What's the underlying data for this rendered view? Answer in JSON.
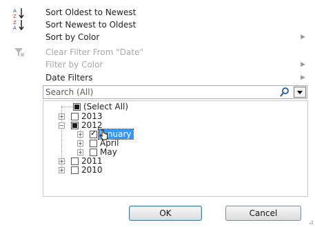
{
  "menu": {
    "items": [
      {
        "label": "Sort Oldest to Newest",
        "enabled": true,
        "submenu": false,
        "icon": "sort-ascending-icon"
      },
      {
        "label": "Sort Newest to Oldest",
        "enabled": true,
        "submenu": false,
        "icon": "sort-descending-icon"
      },
      {
        "label": "Sort by Color",
        "enabled": true,
        "submenu": true,
        "icon": ""
      },
      {
        "label": "Clear Filter From \"Date\"",
        "enabled": false,
        "submenu": false,
        "icon": "clear-filter-icon"
      },
      {
        "label": "Filter by Color",
        "enabled": false,
        "submenu": true,
        "icon": ""
      },
      {
        "label": "Date Filters",
        "enabled": true,
        "submenu": true,
        "icon": ""
      }
    ]
  },
  "search": {
    "placeholder": "Search (All)"
  },
  "tree": {
    "nodes": [
      {
        "label": "(Select All)",
        "state": "mixed",
        "expander": "",
        "selected": false
      },
      {
        "label": "2013",
        "state": "unchecked",
        "expander": "+",
        "selected": false
      },
      {
        "label": "2012",
        "state": "mixed",
        "expander": "−",
        "selected": false
      },
      {
        "label": "January",
        "state": "checked",
        "expander": "+",
        "selected": true
      },
      {
        "label": "April",
        "state": "unchecked",
        "expander": "+",
        "selected": false
      },
      {
        "label": "May",
        "state": "unchecked",
        "expander": "+",
        "selected": false
      },
      {
        "label": "2011",
        "state": "unchecked",
        "expander": "+",
        "selected": false
      },
      {
        "label": "2010",
        "state": "unchecked",
        "expander": "+",
        "selected": false
      }
    ]
  },
  "buttons": {
    "ok": "OK",
    "cancel": "Cancel"
  },
  "colors": {
    "selection": "#3399ff",
    "disabled_text": "#a8a8a8",
    "ok_border": "#3c7fb1"
  }
}
